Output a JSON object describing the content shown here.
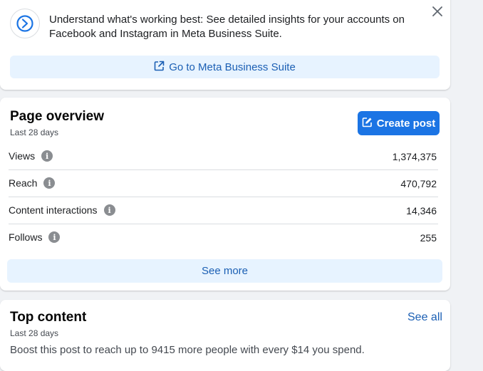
{
  "banner": {
    "icon": "meta-business-suite-icon",
    "text": "Understand what's working best: See detailed insights for your accounts on Facebook and Instagram in Meta Business Suite.",
    "button_label": "Go to Meta Business Suite",
    "accent": "#1b74e4"
  },
  "overview": {
    "title": "Page overview",
    "subtitle": "Last 28 days",
    "create_post_label": "Create post",
    "metrics": [
      {
        "label": "Views",
        "value": "1,374,375"
      },
      {
        "label": "Reach",
        "value": "470,792"
      },
      {
        "label": "Content interactions",
        "value": "14,346"
      },
      {
        "label": "Follows",
        "value": "255"
      }
    ],
    "see_more_label": "See more"
  },
  "top_content": {
    "title": "Top content",
    "subtitle": "Last 28 days",
    "see_all_label": "See all",
    "boost_text": "Boost this post to reach up to 9415 more people with every $14 you spend."
  }
}
